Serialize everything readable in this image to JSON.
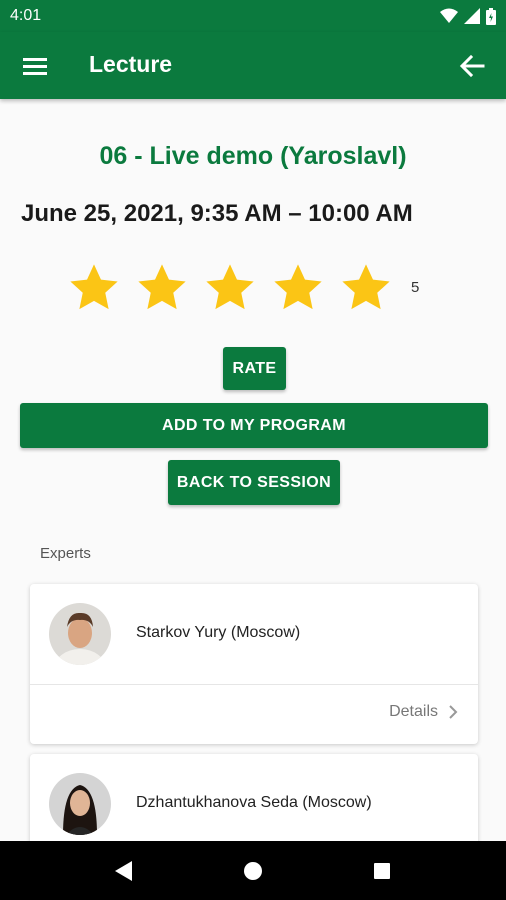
{
  "status_bar": {
    "time": "4:01",
    "icons": [
      "wifi-icon",
      "signal-icon",
      "battery-icon"
    ]
  },
  "app_bar": {
    "title": "Lecture",
    "menu_icon": "hamburger-menu-icon",
    "back_icon": "arrow-left-icon"
  },
  "lecture": {
    "title": "06 - Live demo (Yaroslavl)",
    "time": "June 25, 2021, 9:35 AM – 10:00 AM",
    "rating": {
      "stars_filled": 5,
      "stars_total": 5,
      "value_text": "5"
    }
  },
  "buttons": {
    "rate": "RATE",
    "add_to_program": "ADD TO MY PROGRAM",
    "back_to_session": "BACK TO SESSION"
  },
  "experts": {
    "label": "Experts",
    "items": [
      {
        "name": "Starkov Yury (Moscow)",
        "details_label": "Details"
      },
      {
        "name": "Dzhantukhanova Seda (Moscow)"
      }
    ]
  },
  "colors": {
    "primary": "#0b7a3e",
    "star": "#fbc515",
    "background": "#fafafa"
  },
  "nav_bar": {
    "icons": [
      "back-triangle-icon",
      "home-circle-icon",
      "recents-square-icon"
    ]
  }
}
